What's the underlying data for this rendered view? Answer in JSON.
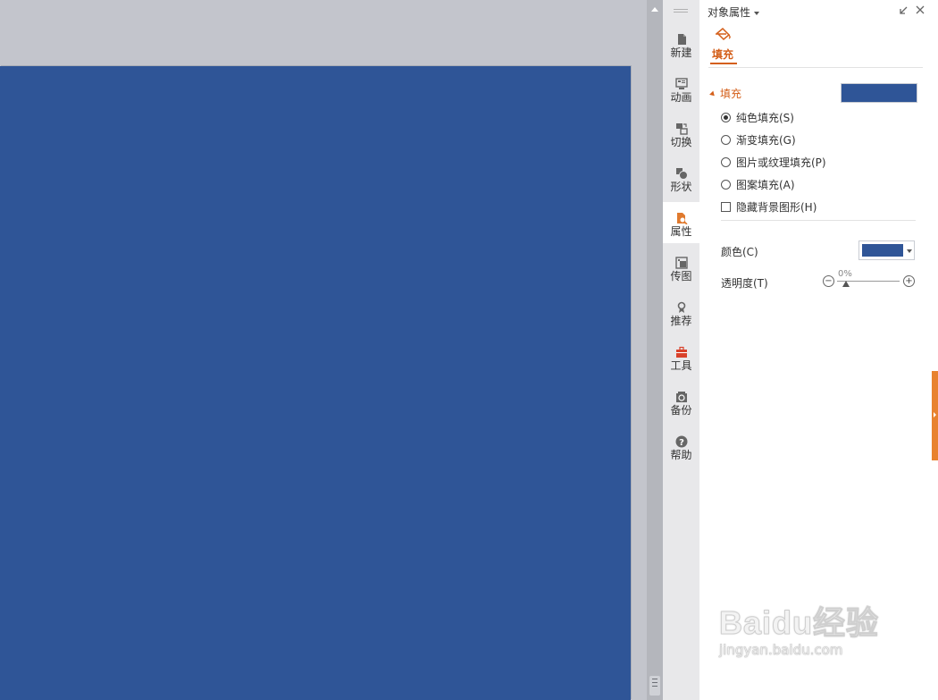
{
  "panel": {
    "title": "对象属性",
    "tab_fill_label": "填充",
    "section_fill_label": "填充",
    "fill_options": [
      {
        "label": "纯色填充(S)",
        "selected": true
      },
      {
        "label": "渐变填充(G)",
        "selected": false
      },
      {
        "label": "图片或纹理填充(P)",
        "selected": false
      },
      {
        "label": "图案填充(A)",
        "selected": false
      }
    ],
    "hide_bg_label": "隐藏背景图形(H)",
    "color_label": "颜色(C)",
    "transparency_label": "透明度(T)",
    "transparency_value": "0%",
    "fill_color": "#2f5597"
  },
  "sidebar": {
    "items": [
      {
        "label": "新建",
        "icon": "new-doc-icon"
      },
      {
        "label": "动画",
        "icon": "animation-icon"
      },
      {
        "label": "切换",
        "icon": "switch-icon"
      },
      {
        "label": "形状",
        "icon": "shape-icon"
      },
      {
        "label": "属性",
        "icon": "property-icon",
        "active": true
      },
      {
        "label": "传图",
        "icon": "upload-image-icon"
      },
      {
        "label": "推荐",
        "icon": "recommend-icon"
      },
      {
        "label": "工具",
        "icon": "toolbox-icon"
      },
      {
        "label": "备份",
        "icon": "backup-icon"
      },
      {
        "label": "帮助",
        "icon": "help-icon"
      }
    ]
  },
  "slide": {
    "background": "#2f5597"
  },
  "colors": {
    "accent": "#d45f1a",
    "slide_blue": "#2f5597",
    "workspace": "#c3c5cc"
  },
  "watermark": {
    "logo_text": "Baidu经验",
    "url": "jingyan.baidu.com"
  }
}
